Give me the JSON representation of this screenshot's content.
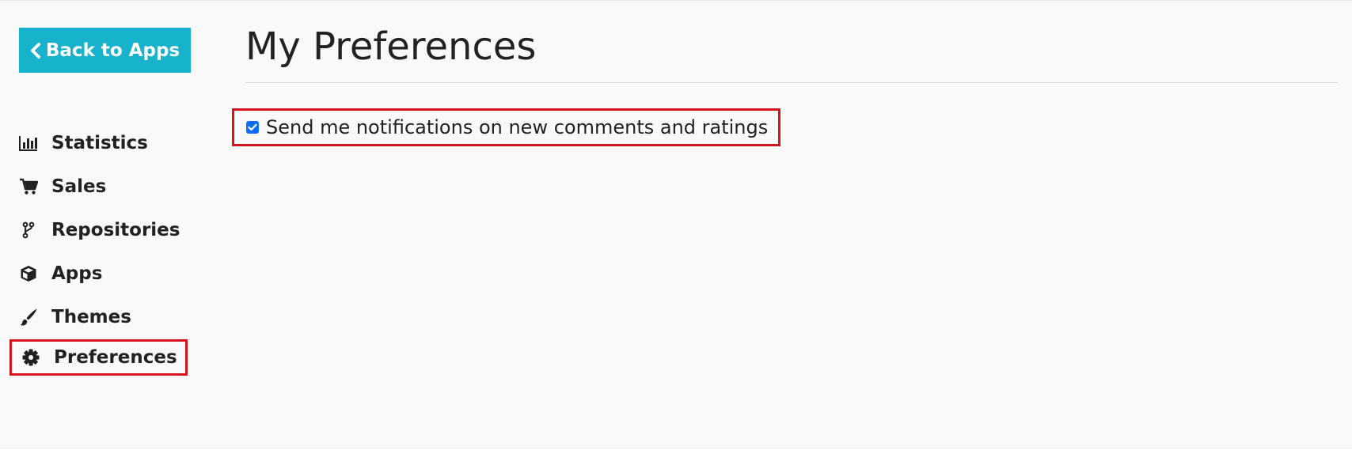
{
  "back_button": {
    "label": "Back to Apps",
    "icon": "chevron-left-icon"
  },
  "sidebar": {
    "items": [
      {
        "label": "Statistics",
        "icon": "bar-chart-icon",
        "highlighted": false
      },
      {
        "label": "Sales",
        "icon": "cart-icon",
        "highlighted": false
      },
      {
        "label": "Repositories",
        "icon": "code-branch-icon",
        "highlighted": false
      },
      {
        "label": "Apps",
        "icon": "cube-icon",
        "highlighted": false
      },
      {
        "label": "Themes",
        "icon": "paint-brush-icon",
        "highlighted": false
      },
      {
        "label": "Preferences",
        "icon": "gear-icon",
        "highlighted": true
      }
    ]
  },
  "main": {
    "title": "My Preferences",
    "notifications_checkbox": {
      "label": "Send me notifications on new comments and ratings",
      "checked": true
    }
  },
  "colors": {
    "accent": "#17b3cc",
    "highlight_border": "#d4141c",
    "checkbox": "#0d6efd",
    "background": "#f9f9f9",
    "text": "#222222"
  }
}
